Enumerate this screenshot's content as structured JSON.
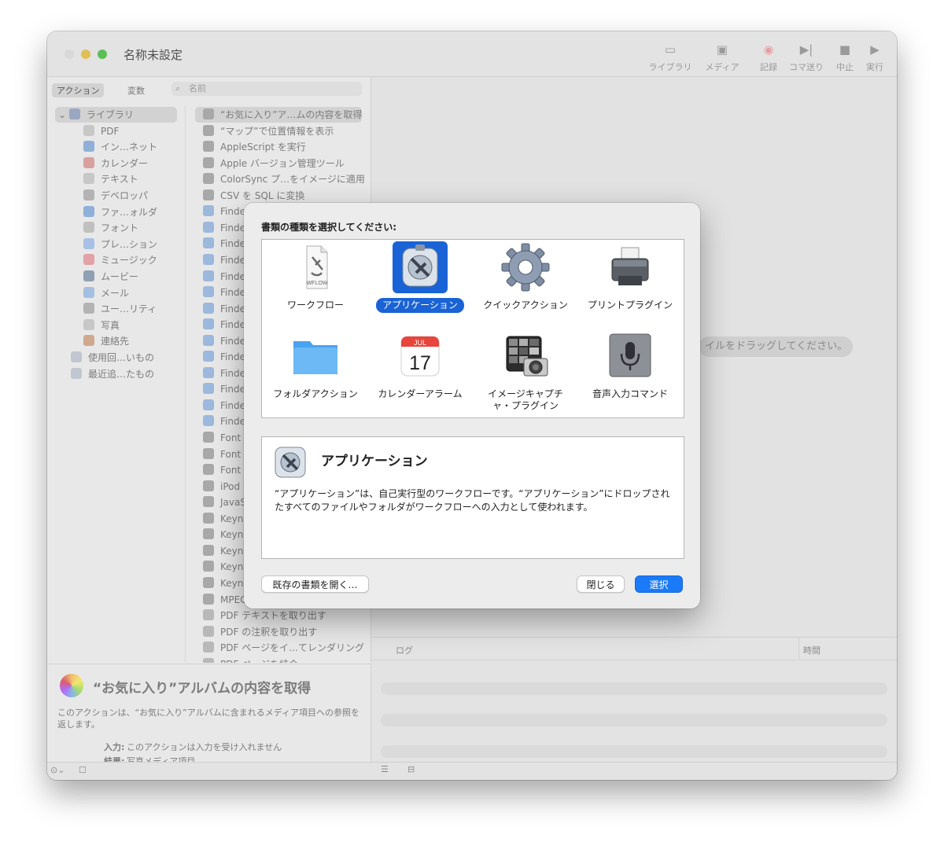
{
  "window": {
    "title": "名称未設定",
    "traffic_lights": [
      "#d8d8d8",
      "#e0c054",
      "#5cbf55"
    ]
  },
  "toolbar": {
    "items": [
      {
        "label": "ライブラリ",
        "icon": "library-icon"
      },
      {
        "label": "メディア",
        "icon": "media-icon"
      },
      {
        "label": "記録",
        "icon": "record-icon"
      },
      {
        "label": "コマ送り",
        "icon": "step-icon"
      },
      {
        "label": "中止",
        "icon": "stop-icon"
      },
      {
        "label": "実行",
        "icon": "run-icon"
      }
    ]
  },
  "left": {
    "tab_actions": "アクション",
    "tab_variables": "変数",
    "search_placeholder": "名前",
    "library_items": [
      "ライブラリ",
      "PDF",
      "イン…ネット",
      "カレンダー",
      "テキスト",
      "デベロッパ",
      "ファ…ォルダ",
      "フォント",
      "プレ…ション",
      "ミュージック",
      "ムービー",
      "メール",
      "ユー…リティ",
      "写真",
      "連絡先",
      "使用回…いもの",
      "最近追…たもの"
    ],
    "action_items": [
      "“お気に入り”ア…ムの内容を取得",
      "“マップ”で位置情報を表示",
      "AppleScript を実行",
      "Apple バージョン管理ツール",
      "ColorSync プ…をイメージに適用",
      "CSV を SQL に変換",
      "Finder",
      "Finder",
      "Finder",
      "Finder",
      "Finder",
      "Finder",
      "Finder",
      "Finder",
      "Finder",
      "Finder",
      "Finder",
      "Finder",
      "Finder",
      "Finder",
      "Font",
      "Font",
      "Font",
      "iPod",
      "JavaS",
      "Keyno",
      "Keyno",
      "Keyno",
      "Keyno",
      "Keyno",
      "MPEG",
      "PDF テキストを取り出す",
      "PDF の注釈を取り出す",
      "PDF ページをイ…てレンダリング",
      "PDF ページを結合"
    ]
  },
  "description": {
    "title": "“お気に入り”アルバムの内容を取得",
    "body": "このアクションは、“お気に入り”アルバムに含まれるメディア項目への参照を返します。",
    "input_label": "入力:",
    "input_value": "このアクションは入力を受け入れません",
    "result_label": "結果:",
    "result_value": "写真メディア項目"
  },
  "main": {
    "drop_hint": "イルをドラッグしてください。"
  },
  "log": {
    "col_log": "ログ",
    "col_time": "時間"
  },
  "dialog": {
    "prompt": "書類の種類を選択してください:",
    "types": [
      {
        "label": "ワークフロー",
        "icon": "workflow-file-icon",
        "badge": "WFLOW"
      },
      {
        "label": "アプリケーション",
        "icon": "automator-app-icon"
      },
      {
        "label": "クイックアクション",
        "icon": "gear-icon"
      },
      {
        "label": "プリントプラグイン",
        "icon": "printer-icon"
      },
      {
        "label": "フォルダアクション",
        "icon": "folder-icon"
      },
      {
        "label": "カレンダーアラーム",
        "icon": "calendar-icon",
        "month": "JUL",
        "day": "17"
      },
      {
        "label": "イメージキャプチャ・プラグイン",
        "icon": "image-capture-icon"
      },
      {
        "label": "音声入力コマンド",
        "icon": "microphone-icon"
      }
    ],
    "selected_index": 1,
    "info_title": "アプリケーション",
    "info_body": "“アプリケーション”は、自己実行型のワークフローです。“アプリケーション”にドロップされたすべてのファイルやフォルダがワークフローへの入力として使われます。",
    "btn_open": "既存の書類を開く…",
    "btn_close": "閉じる",
    "btn_choose": "選択"
  },
  "colors": {
    "accent": "#1a63d6",
    "primary_button": "#1a7af8"
  }
}
